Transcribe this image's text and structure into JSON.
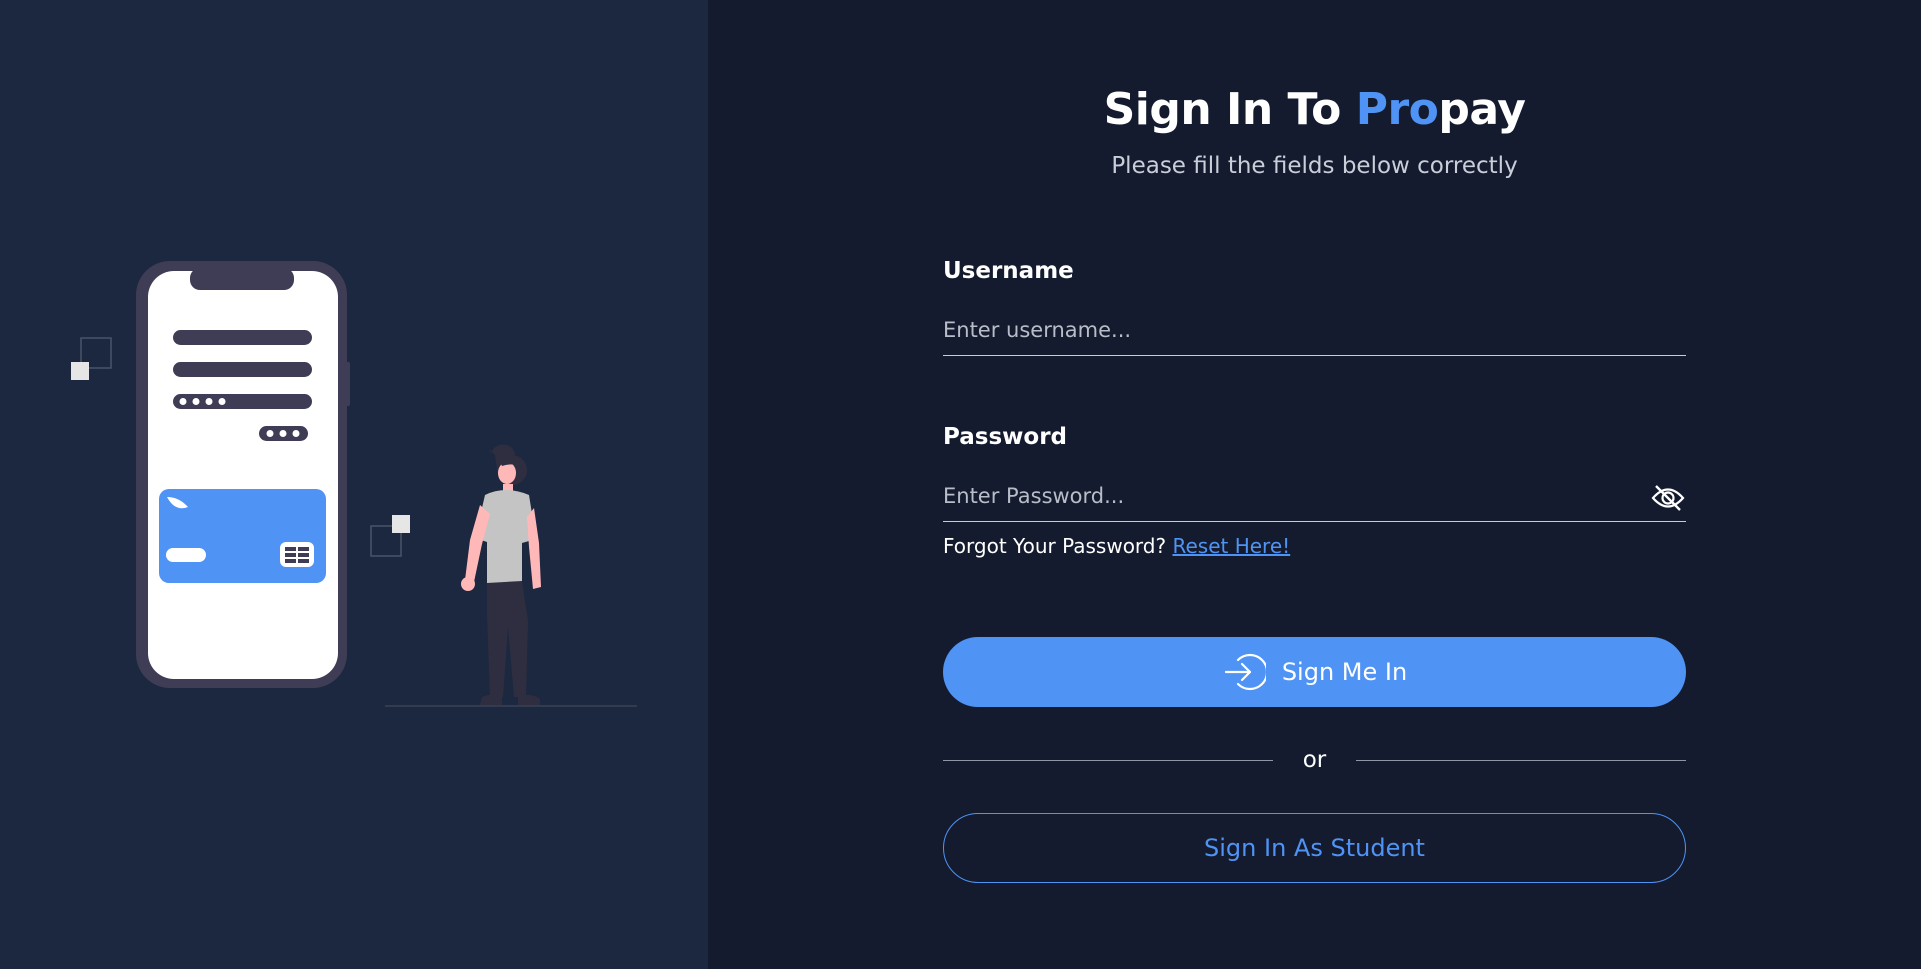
{
  "heading": {
    "prefix": "Sign In To ",
    "brand_accent": "Pro",
    "brand_rest": "pay",
    "subtitle": "Please fill the fields below correctly"
  },
  "form": {
    "username_label": "Username",
    "username_placeholder": "Enter username...",
    "username_value": "",
    "password_label": "Password",
    "password_placeholder": "Enter Password...",
    "password_value": "",
    "forgot_text": "Forgot Your Password?",
    "reset_link": "Reset Here!"
  },
  "actions": {
    "sign_in_label": "Sign Me In",
    "sign_in_icon": "login-arrow-icon",
    "or_text": "or",
    "student_label": "Sign In As Student"
  },
  "icons": {
    "password_toggle": "eye-off-icon",
    "illustration": "phone-payment-person-illustration"
  },
  "colors": {
    "accent": "#4f93f5",
    "left_panel_bg": "#1c2740",
    "right_panel_bg": "#141b2e"
  }
}
